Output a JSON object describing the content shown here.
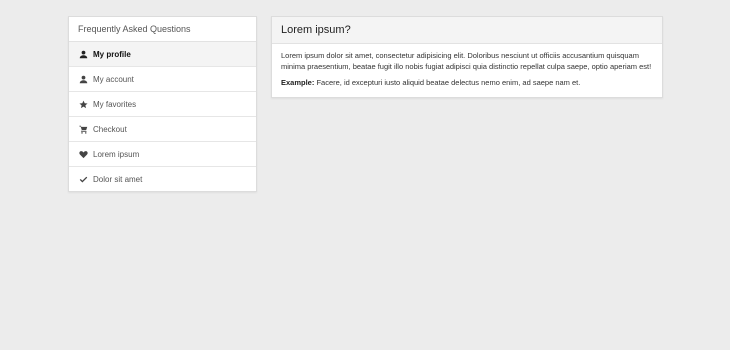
{
  "sidebar": {
    "title": "Frequently Asked Questions",
    "items": [
      {
        "label": "My profile",
        "icon": "person-icon",
        "active": true
      },
      {
        "label": "My account",
        "icon": "person-icon",
        "active": false
      },
      {
        "label": "My favorites",
        "icon": "star-icon",
        "active": false
      },
      {
        "label": "Checkout",
        "icon": "cart-icon",
        "active": false
      },
      {
        "label": "Lorem ipsum",
        "icon": "heart-icon",
        "active": false
      },
      {
        "label": "Dolor sit amet",
        "icon": "check-icon",
        "active": false
      }
    ]
  },
  "panel": {
    "title": "Lorem ipsum?",
    "paragraph": "Lorem ipsum dolor sit amet, consectetur adipisicing elit. Doloribus nesciunt ut officiis accusantium quisquam minima praesentium, beatae fugit illo nobis fugiat adipisci quia distinctio repellat culpa saepe, optio aperiam est!",
    "example_label": "Example:",
    "example_text": " Facere, id excepturi iusto aliquid beatae delectus nemo enim, ad saepe nam et."
  },
  "colors": {
    "background": "#ececec",
    "card": "#ffffff",
    "active_item": "#f4f4f4"
  }
}
